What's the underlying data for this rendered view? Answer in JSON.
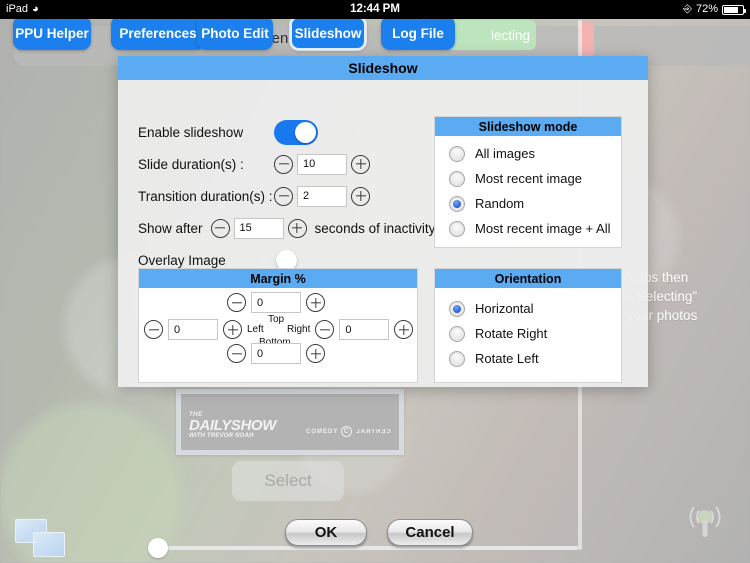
{
  "status_bar": {
    "device": "iPad",
    "wifi_icon": "wifi-icon",
    "time": "12:44 PM",
    "lock_rotation_icon": "rotation-lock-icon",
    "battery_percent": "72%"
  },
  "toolbar": {
    "buttons": [
      {
        "label": "PPU Helper",
        "name": "ppu-helper",
        "selected": false
      },
      {
        "label": "Preferences",
        "name": "preferences",
        "selected": false
      },
      {
        "label": "Photo Edit",
        "name": "photo-edit",
        "selected": false
      },
      {
        "label": "Slideshow",
        "name": "slideshow",
        "selected": true
      },
      {
        "label": "Log File",
        "name": "log-file",
        "selected": false
      }
    ]
  },
  "background_app": {
    "hint_text": "ou                    en                    e",
    "done_selecting_label": "lecting",
    "instructions": [
      "ect photos then",
      "\"Done Selecting\"",
      "hare your photos"
    ],
    "select_button_label": "Select",
    "photo": {
      "the": "THE",
      "title": "DAILYSHOW",
      "subtitle": "WITH TREVOR NOAH",
      "network_left": "COMEDY",
      "network_mark": "C",
      "network_right": "CENTRAL"
    },
    "stack_icon": "stacked-photos-icon",
    "broadcast_icon": "airplay-broadcast-icon"
  },
  "dialog": {
    "title": "Slideshow",
    "enable": {
      "label": "Enable slideshow",
      "state": "on"
    },
    "slide_duration": {
      "label": "Slide duration(s) :",
      "value": "10",
      "minus": "minus-icon",
      "plus": "plus-icon"
    },
    "transition_duration": {
      "label": "Transition duration(s) :",
      "value": "2",
      "minus": "minus-icon",
      "plus": "plus-icon"
    },
    "show_after": {
      "label_before": "Show after",
      "value": "15",
      "label_after": "seconds of inactivity"
    },
    "overlay_image": {
      "label": "Overlay Image",
      "state": "off"
    },
    "slideshow_mode": {
      "title": "Slideshow mode",
      "options": [
        {
          "label": "All images",
          "selected": false
        },
        {
          "label": "Most recent image",
          "selected": false
        },
        {
          "label": "Random",
          "selected": true
        },
        {
          "label": "Most recent image + All",
          "selected": false
        }
      ]
    },
    "orientation": {
      "title": "Orientation",
      "options": [
        {
          "label": "Horizontal",
          "selected": true
        },
        {
          "label": "Rotate Right",
          "selected": false
        },
        {
          "label": "Rotate Left",
          "selected": false
        }
      ]
    },
    "margin": {
      "title": "Margin %",
      "top": {
        "caption": "Top",
        "value": "0"
      },
      "left": {
        "caption": "Left",
        "value": "0"
      },
      "right": {
        "caption": "Right",
        "value": "0"
      },
      "bottom": {
        "caption": "Bottom",
        "value": "0"
      }
    }
  },
  "footer": {
    "ok_label": "OK",
    "cancel_label": "Cancel"
  },
  "colors": {
    "accent_blue": "#1b7fee",
    "header_blue": "#5aabf2",
    "toggle_on": "#1778f0",
    "radio_selected": "#0b3fc4",
    "done_green": "#bde5bd"
  }
}
